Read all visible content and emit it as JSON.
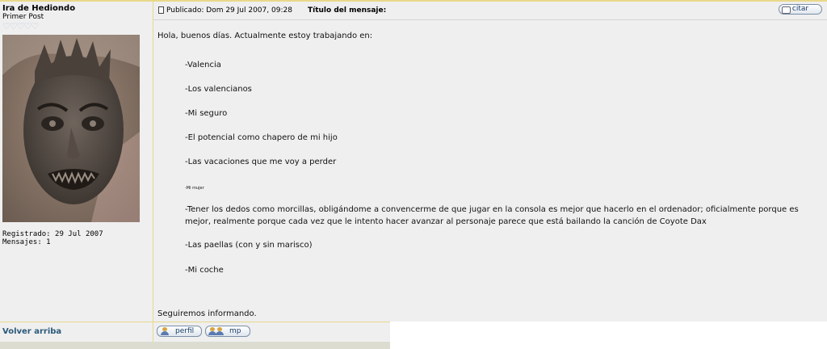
{
  "post": {
    "author": "Ira de Hediondo",
    "rank": "Primer Post",
    "stars": "♡♡♡♡♡",
    "registered": "Registrado: 29 Jul 2007",
    "messages": "Mensajes: 1",
    "published": "Publicado: Dom 29 Jul 2007, 09:28",
    "subject_label": "Título del mensaje:",
    "quote_label": "citar",
    "body": {
      "intro": "Hola, buenos días. Actualmente estoy trabajando en:",
      "items": [
        "-Valencia",
        "-Los valencianos",
        "-Mi seguro",
        "-El potencial como chapero de mi hijo",
        "-Las vacaciones que me voy a perder",
        "-Mi mujer",
        "-Tener los dedos como morcillas, obligándome a convencerme de que jugar en la consola es mejor que hacerlo en el ordenador; oficialmente porque es",
        "mejor, realmente porque cada vez que le intento  hacer avanzar al personaje parece que está bailando la canción de Coyote Dax",
        "-Las paellas (con y sin marisco)",
        "-Mi coche"
      ],
      "closing": "Seguiremos informando."
    }
  },
  "footer": {
    "back_to_top": "Volver arriba",
    "profile_label": "perfil",
    "pm_label": "mp"
  }
}
